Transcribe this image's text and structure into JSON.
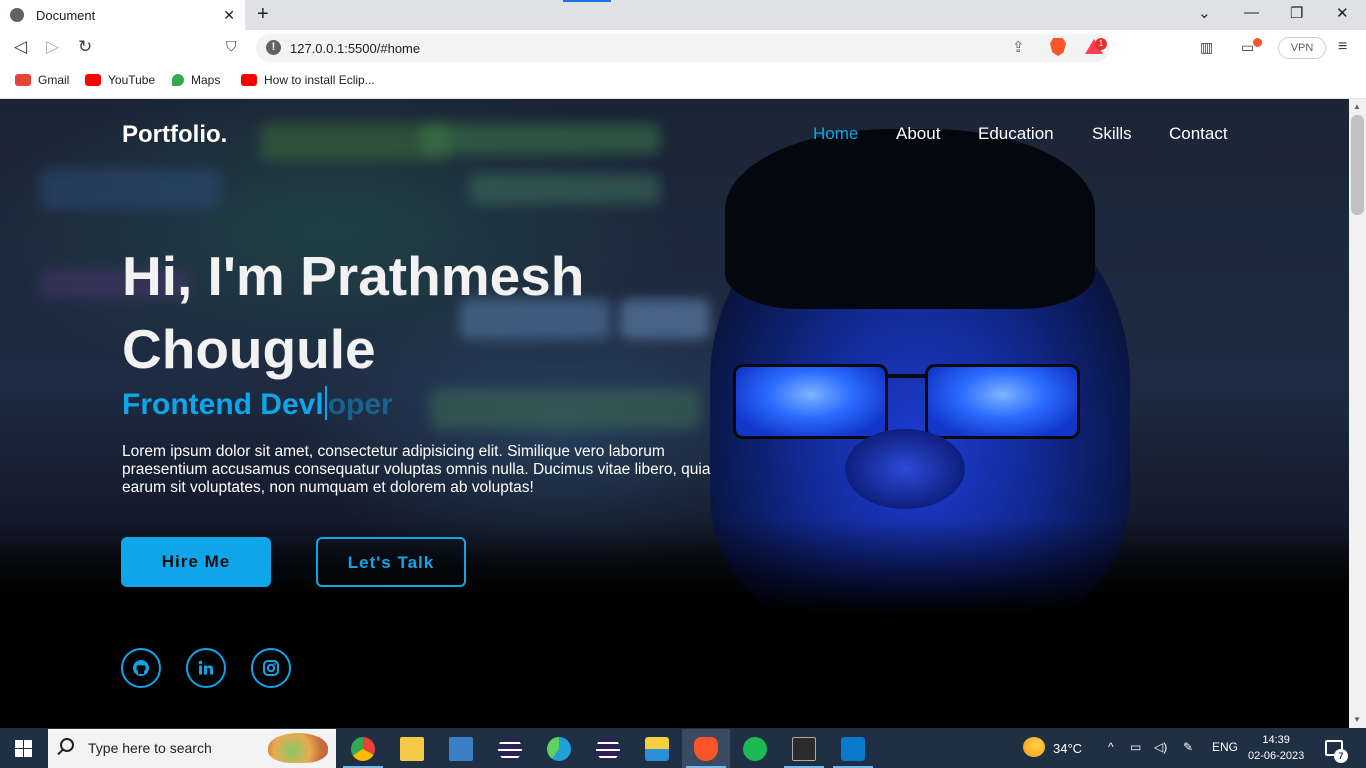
{
  "browser": {
    "tab_title": "Document",
    "tab_close": "✕",
    "new_tab": "+",
    "url": "127.0.0.1:5500/#home",
    "vpn_label": "VPN",
    "rewards_count": "1",
    "window_controls": {
      "tab_search": "⌄",
      "minimize": "—",
      "restore": "❐",
      "close": "✕"
    },
    "nav": {
      "back": "◁",
      "forward": "▷",
      "reload": "↻",
      "bookmark": "⛉"
    },
    "bookmarks": [
      {
        "label": "Gmail",
        "icon": "gmail-icon",
        "color": "#ea4335"
      },
      {
        "label": "YouTube",
        "icon": "youtube-icon",
        "color": "#ff0000"
      },
      {
        "label": "Maps",
        "icon": "maps-icon",
        "color": "#34a853"
      },
      {
        "label": "How to install Eclip...",
        "icon": "youtube-icon",
        "color": "#ff0000"
      }
    ]
  },
  "page": {
    "logo": "Portfolio.",
    "nav": [
      {
        "label": "Home",
        "active": true
      },
      {
        "label": "About",
        "active": false
      },
      {
        "label": "Education",
        "active": false
      },
      {
        "label": "Skills",
        "active": false
      },
      {
        "label": "Contact",
        "active": false
      }
    ],
    "hero": {
      "title": "Hi, I'm Prathmesh Chougule",
      "subtitle_typed": "Frontend Devl",
      "subtitle_ghost": "oper",
      "description": "Lorem ipsum dolor sit amet, consectetur adipisicing elit. Similique vero laborum praesentium accusamus consequatur voluptas omnis nulla. Ducimus vitae libero, quia earum sit voluptates, non numquam et dolorem ab voluptas!",
      "primary_button": "Hire Me",
      "secondary_button": "Let's Talk"
    },
    "social": [
      {
        "icon": "github-icon"
      },
      {
        "icon": "linkedin-icon"
      },
      {
        "icon": "instagram-icon"
      }
    ],
    "accent_color": "#0ea5e9"
  },
  "taskbar": {
    "search_placeholder": "Type here to search",
    "apps": [
      {
        "name": "chrome-icon",
        "color": "#4285f4"
      },
      {
        "name": "file-explorer-icon",
        "color": "#f7c948"
      },
      {
        "name": "sql-tool-icon",
        "color": "#3b7fc4"
      },
      {
        "name": "eclipse-icon",
        "color": "#2c2255"
      },
      {
        "name": "edge-icon",
        "color": "#1fa0d8"
      },
      {
        "name": "eclipse-ee-icon",
        "color": "#2c2255"
      },
      {
        "name": "installer-icon",
        "color": "#f5d142"
      },
      {
        "name": "brave-icon",
        "color": "#fb542b"
      },
      {
        "name": "spotify-icon",
        "color": "#1db954"
      },
      {
        "name": "terminal-icon",
        "color": "#2b2b2b"
      },
      {
        "name": "vscode-icon",
        "color": "#0a7acc"
      }
    ],
    "temperature": "34°C",
    "language": "ENG",
    "time": "14:39",
    "date": "02-06-2023",
    "notification_count": "7"
  }
}
